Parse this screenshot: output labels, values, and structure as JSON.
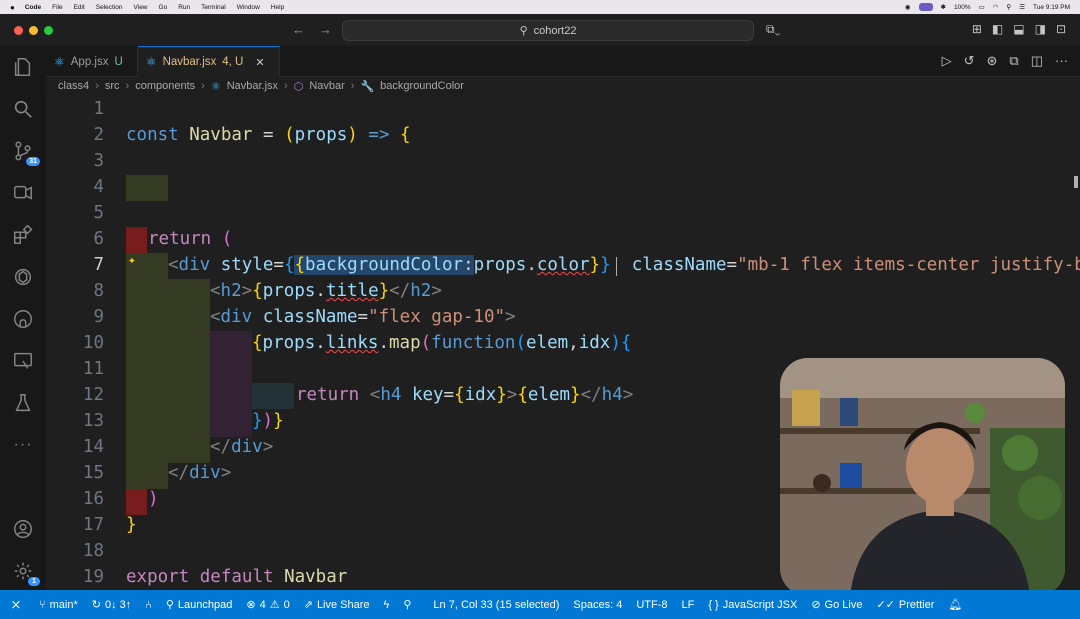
{
  "menubar": {
    "apple": "",
    "items": [
      "Code",
      "File",
      "Edit",
      "Selection",
      "View",
      "Go",
      "Run",
      "Terminal",
      "Window",
      "Help"
    ],
    "battery": "100%",
    "clock": "Tue 9:19 PM"
  },
  "titlebar": {
    "search_text": "cohort22"
  },
  "activity": {
    "scm_badge": "31",
    "settings_badge": "1"
  },
  "tabs": [
    {
      "label": "App.jsx",
      "status": "U"
    },
    {
      "label": "Navbar.jsx",
      "status": "4, U"
    }
  ],
  "breadcrumb": [
    "class4",
    "src",
    "components",
    "Navbar.jsx",
    "Navbar",
    "backgroundColor"
  ],
  "editor": {
    "line_numbers": [
      "1",
      "2",
      "3",
      "4",
      "5",
      "6",
      "7",
      "8",
      "9",
      "10",
      "11",
      "12",
      "13",
      "14",
      "15",
      "16",
      "17",
      "18",
      "19"
    ],
    "current_line": "7"
  },
  "statusbar": {
    "branch": "main*",
    "sync": "0↓ 3↑",
    "launchpad": "Launchpad",
    "errors": "4",
    "warnings": "0",
    "live_share": "Live Share",
    "position": "Ln 7, Col 33 (15 selected)",
    "spaces": "Spaces: 4",
    "encoding": "UTF-8",
    "eol": "LF",
    "language": "JavaScript JSX",
    "go_live": "Go Live",
    "prettier": "Prettier"
  },
  "colors": {
    "accent": "#0078d4",
    "editor_bg": "#1f1f1f",
    "modified_tab": "#e2c08d"
  }
}
